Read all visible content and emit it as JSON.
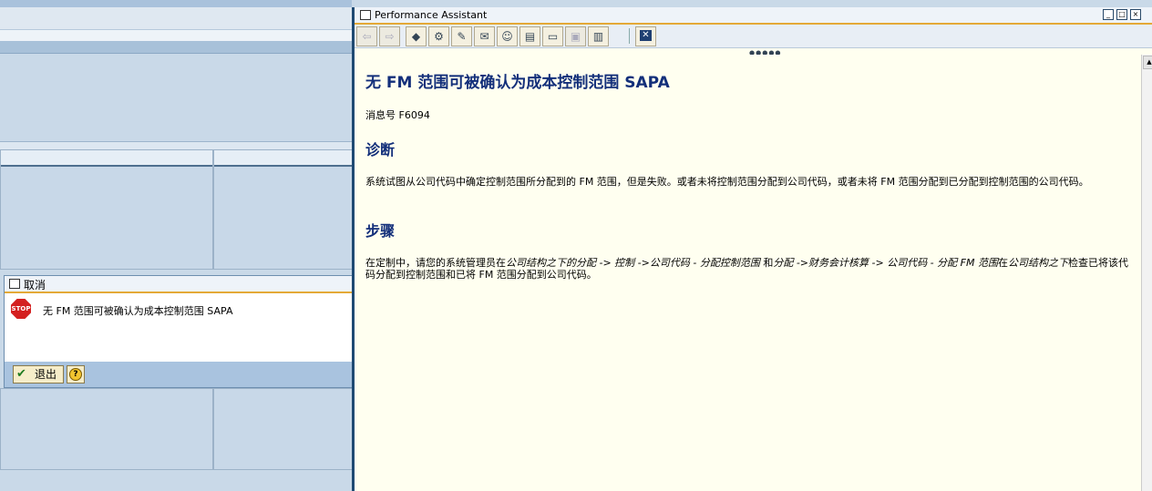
{
  "popup": {
    "title": "取消",
    "icon": "stop-icon",
    "stop_text": "STOP",
    "message": "无 FM 范围可被确认为成本控制范围 SAPA",
    "exit_label": "退出"
  },
  "pa": {
    "title": "Performance Assistant",
    "heading": "无  FM 范围可被确认为成本控制范围  SAPA",
    "message_number": "消息号  F6094",
    "diagnosis_heading": "诊断",
    "diagnosis_text": "系统试图从公司代码中确定控制范围所分配到的  FM 范围，但是失败。或者未将控制范围分配到公司代码，或者未将  FM 范围分配到已分配到控制范围的公司代码。",
    "steps_heading": "步骤",
    "steps": {
      "t1": "在定制中，请您的系统管理员在",
      "i1": "公司结构之下的分配 -> 控制 ->公司代码 - 分配控制范围",
      "t2": " 和",
      "i2": "分配 ->财务会计核算 -> 公司代码 - 分配 FM 范围",
      "t3": "在",
      "i3": "公司结构之下",
      "t4": "检查已将该代码分配到控制范围和已将  FM 范围分配到公司代码。"
    }
  }
}
